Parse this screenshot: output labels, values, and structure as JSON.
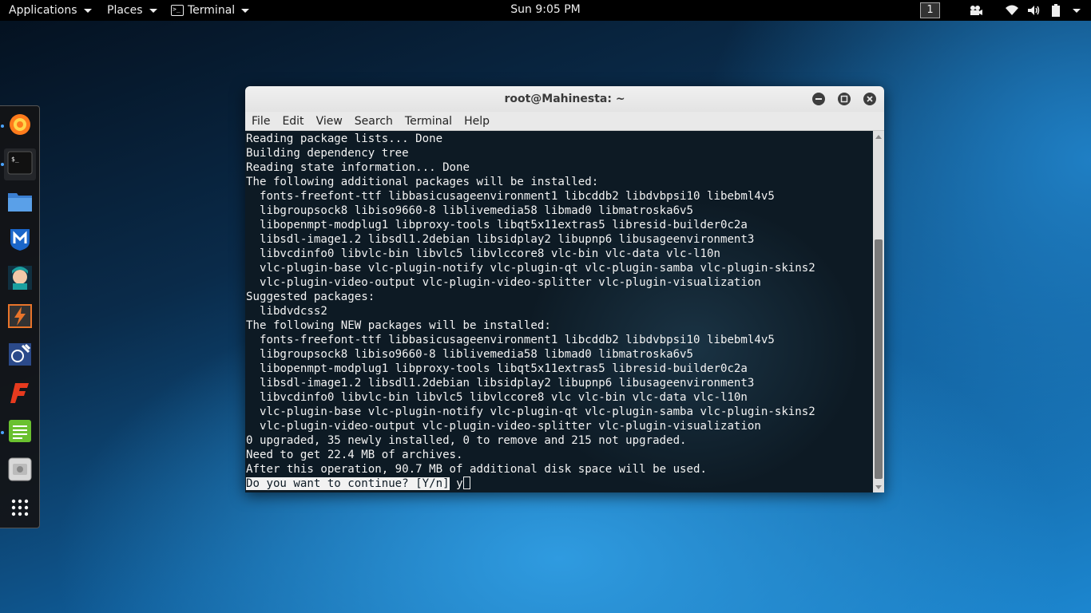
{
  "topbar": {
    "applications": "Applications",
    "places": "Places",
    "terminal": "Terminal",
    "clock": "Sun  9:05 PM",
    "workspace": "1"
  },
  "dock": {
    "items": [
      {
        "name": "firefox-icon",
        "color": "#ff7b1c",
        "active": true
      },
      {
        "name": "terminal-icon",
        "color": "#111111",
        "active": true
      },
      {
        "name": "files-icon",
        "color": "#3b7fd1",
        "active": false
      },
      {
        "name": "metasploit-icon",
        "color": "#1b66c9",
        "active": false
      },
      {
        "name": "armitage-icon",
        "color": "#1aa0a0",
        "active": false
      },
      {
        "name": "burpsuite-icon",
        "color": "#e8742a",
        "active": false
      },
      {
        "name": "maltego-icon",
        "color": "#2b4a8a",
        "active": false
      },
      {
        "name": "faraday-icon",
        "color": "#e63a1e",
        "active": false
      },
      {
        "name": "notes-icon",
        "color": "#6ac12f",
        "active": true
      },
      {
        "name": "screenshot-icon",
        "color": "#d9d9d9",
        "active": false
      },
      {
        "name": "show-apps-icon",
        "color": "#ffffff",
        "active": false
      }
    ]
  },
  "window": {
    "title": "root@Mahinesta: ~",
    "menu": [
      "File",
      "Edit",
      "View",
      "Search",
      "Terminal",
      "Help"
    ]
  },
  "terminal": {
    "lines": [
      "Reading package lists... Done",
      "Building dependency tree",
      "Reading state information... Done",
      "The following additional packages will be installed:",
      "  fonts-freefont-ttf libbasicusageenvironment1 libcddb2 libdvbpsi10 libebml4v5",
      "  libgroupsock8 libiso9660-8 liblivemedia58 libmad0 libmatroska6v5",
      "  libopenmpt-modplug1 libproxy-tools libqt5x11extras5 libresid-builder0c2a",
      "  libsdl-image1.2 libsdl1.2debian libsidplay2 libupnp6 libusageenvironment3",
      "  libvcdinfo0 libvlc-bin libvlc5 libvlccore8 vlc-bin vlc-data vlc-l10n",
      "  vlc-plugin-base vlc-plugin-notify vlc-plugin-qt vlc-plugin-samba vlc-plugin-skins2",
      "  vlc-plugin-video-output vlc-plugin-video-splitter vlc-plugin-visualization",
      "Suggested packages:",
      "  libdvdcss2",
      "The following NEW packages will be installed:",
      "  fonts-freefont-ttf libbasicusageenvironment1 libcddb2 libdvbpsi10 libebml4v5",
      "  libgroupsock8 libiso9660-8 liblivemedia58 libmad0 libmatroska6v5",
      "  libopenmpt-modplug1 libproxy-tools libqt5x11extras5 libresid-builder0c2a",
      "  libsdl-image1.2 libsdl1.2debian libsidplay2 libupnp6 libusageenvironment3",
      "  libvcdinfo0 libvlc-bin libvlc5 libvlccore8 vlc vlc-bin vlc-data vlc-l10n",
      "  vlc-plugin-base vlc-plugin-notify vlc-plugin-qt vlc-plugin-samba vlc-plugin-skins2",
      "  vlc-plugin-video-output vlc-plugin-video-splitter vlc-plugin-visualization",
      "0 upgraded, 35 newly installed, 0 to remove and 215 not upgraded.",
      "Need to get 22.4 MB of archives.",
      "After this operation, 90.7 MB of additional disk space will be used."
    ],
    "prompt": "Do you want to continue? [Y/n]",
    "input": "y"
  }
}
